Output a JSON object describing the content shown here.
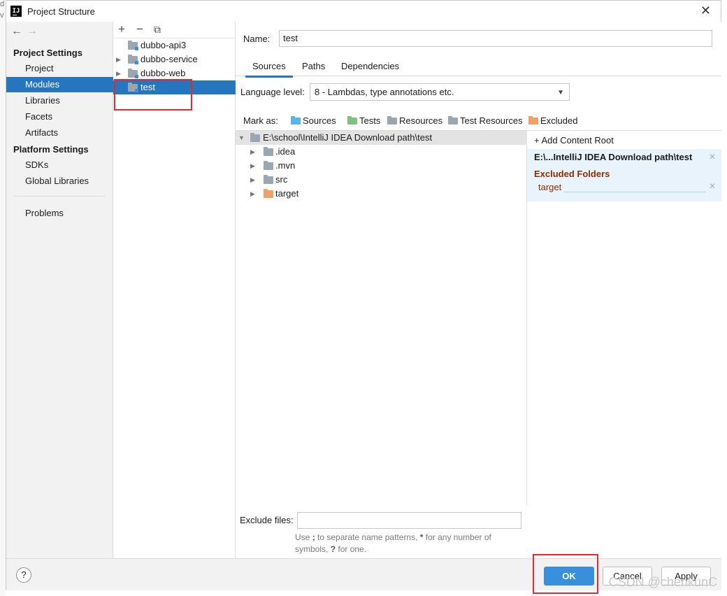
{
  "window": {
    "title": "Project Structure"
  },
  "sidebar": {
    "section1": "Project Settings",
    "items1": [
      {
        "label": "Project"
      },
      {
        "label": "Modules"
      },
      {
        "label": "Libraries"
      },
      {
        "label": "Facets"
      },
      {
        "label": "Artifacts"
      }
    ],
    "section2": "Platform Settings",
    "items2": [
      {
        "label": "SDKs"
      },
      {
        "label": "Global Libraries"
      }
    ],
    "problems": "Problems"
  },
  "modules": [
    {
      "label": "dubbo-api3"
    },
    {
      "label": "dubbo-service"
    },
    {
      "label": "dubbo-web"
    },
    {
      "label": "test"
    }
  ],
  "module_settings": {
    "name_label": "Name:",
    "name_value": "test",
    "tabs": [
      {
        "label": "Sources"
      },
      {
        "label": "Paths"
      },
      {
        "label": "Dependencies"
      }
    ],
    "language_label": "Language level:",
    "language_value": "8 - Lambdas, type annotations etc.",
    "mark_as_label": "Mark as:",
    "mark_items": [
      {
        "label": "Sources",
        "color": "#5ab4e6"
      },
      {
        "label": "Tests",
        "color": "#7ec27e"
      },
      {
        "label": "Resources",
        "color": "#9aa7b0"
      },
      {
        "label": "Test Resources",
        "color": "#9aa7b0"
      },
      {
        "label": "Excluded",
        "color": "#f0a06a"
      }
    ]
  },
  "tree": {
    "root": "E:\\school\\IntelliJ IDEA Download path\\test",
    "children": [
      {
        "label": ".idea",
        "color": "#9aa7b0"
      },
      {
        "label": ".mvn",
        "color": "#9aa7b0"
      },
      {
        "label": "src",
        "color": "#9aa7b0"
      },
      {
        "label": "target",
        "color": "#f0a06a"
      }
    ]
  },
  "content_roots": {
    "add_label": "+ Add Content Root",
    "path": "E:\\...IntelliJ IDEA Download path\\test",
    "excluded_title": "Excluded Folders",
    "excluded_items": [
      "target"
    ]
  },
  "exclude_files": {
    "label": "Exclude files:",
    "value": "",
    "hint_1": "Use ",
    "hint_2": ";",
    "hint_3": " to separate name patterns, ",
    "hint_4": "*",
    "hint_5": " for any number of symbols, ",
    "hint_6": "?",
    "hint_7": " for one."
  },
  "footer": {
    "help": "?",
    "ok": "OK",
    "cancel": "Cancel",
    "apply": "Apply"
  },
  "watermark": "CSDN @chenkunC"
}
